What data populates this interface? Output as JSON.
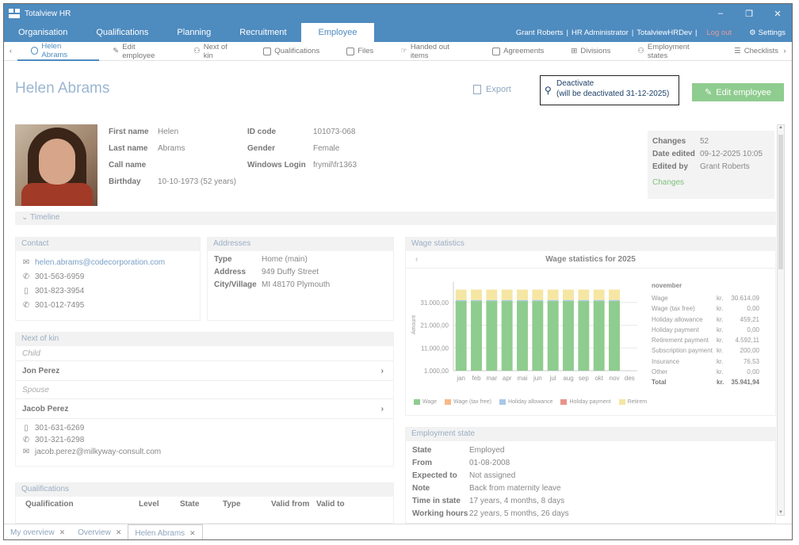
{
  "window": {
    "title": "Totalview HR",
    "minimize": "–",
    "restore": "❐",
    "close": "✕"
  },
  "main_nav": {
    "tabs": [
      "Organisation",
      "Qualifications",
      "Planning",
      "Recruitment",
      "Employee"
    ],
    "active": "Employee",
    "user": "Grant Roberts",
    "role": "HR Administrator",
    "instance": "TotalviewHRDev",
    "sep": "|",
    "logout": "Log out",
    "settings": "Settings"
  },
  "sub_nav": {
    "items": [
      "Helen Abrams",
      "Edit employee",
      "Next of kin",
      "Qualifications",
      "Files",
      "Handed out items",
      "Agreements",
      "Divisions",
      "Employment states",
      "Checklists"
    ],
    "left_arrow": "‹",
    "right_arrow": "›"
  },
  "header": {
    "name": "Helen Abrams",
    "export": "Export",
    "deactivate": "Deactivate",
    "deactivate_note": "(will be deactivated 31-12-2025)",
    "edit_button": "Edit employee"
  },
  "person": {
    "first_name_label": "First name",
    "first_name": "Helen",
    "last_name_label": "Last name",
    "last_name": "Abrams",
    "call_name_label": "Call name",
    "call_name": "",
    "birthday_label": "Birthday",
    "birthday": "10-10-1973 (52 years)",
    "id_label": "ID code",
    "id": "101073-068",
    "gender_label": "Gender",
    "gender": "Female",
    "login_label": "Windows Login",
    "login": "frymil\\fr1363"
  },
  "meta": {
    "changes_label": "Changes",
    "changes": "52",
    "edited_label": "Date edited",
    "edited": "09-12-2025 10:05",
    "by_label": "Edited by",
    "by": "Grant Roberts",
    "link": "Changes"
  },
  "timeline": {
    "label": "Timeline",
    "chevron": "⌄"
  },
  "contact": {
    "title": "Contact",
    "email": "helen.abrams@codecorporation.com",
    "phone1": "301-563-6959",
    "phone2": "301-823-3954",
    "phone3": "301-012-7495"
  },
  "addresses": {
    "title": "Addresses",
    "type_label": "Type",
    "type": "Home (main)",
    "address_label": "Address",
    "address": "949 Duffy Street",
    "city_label": "City/Village",
    "city": "MI 48170 Plymouth"
  },
  "next_of_kin": {
    "title": "Next of kin",
    "child_label": "Child",
    "child_name": "Jon Perez",
    "spouse_label": "Spouse",
    "spouse_name": "Jacob Perez",
    "spouse_mobile": "301-631-6269",
    "spouse_phone": "301-321-6298",
    "spouse_email": "jacob.perez@milkyway-consult.com",
    "chevron": "›"
  },
  "qualifications": {
    "title": "Qualifications",
    "columns": [
      "Qualification",
      "Level",
      "State",
      "Type",
      "Valid from",
      "Valid to"
    ]
  },
  "wage": {
    "title": "Wage statistics",
    "chart_title": "Wage statistics for 2025",
    "back": "‹",
    "month": "november",
    "rows": [
      {
        "name": "Wage",
        "cur": "kr.",
        "amount": "30.614,09"
      },
      {
        "name": "Wage (tax free)",
        "cur": "kr.",
        "amount": "0,00"
      },
      {
        "name": "Holiday allowance",
        "cur": "kr.",
        "amount": "459,21"
      },
      {
        "name": "Holiday payment",
        "cur": "kr.",
        "amount": "0,00"
      },
      {
        "name": "Retirement payment",
        "cur": "kr.",
        "amount": "4.592,11"
      },
      {
        "name": "Subscription payment",
        "cur": "kr.",
        "amount": "200,00"
      },
      {
        "name": "Insurance",
        "cur": "kr.",
        "amount": "76,53"
      },
      {
        "name": "Other",
        "cur": "kr.",
        "amount": "0,00"
      },
      {
        "name": "Total",
        "cur": "kr.",
        "amount": "35.941,94"
      }
    ]
  },
  "employment": {
    "title": "Employment state",
    "state_label": "State",
    "state": "Employed",
    "from_label": "From",
    "from": "01-08-2008",
    "expected_label": "Expected to",
    "expected": "Not assigned",
    "note_label": "Note",
    "note": "Back from maternity leave",
    "time_label": "Time in state",
    "time": "17 years, 4 months, 8 days",
    "hours_label": "Working hours",
    "hours": "22 years, 5 months, 26 days"
  },
  "bottom_tabs": [
    "My overview",
    "Overview",
    "Helen Abrams"
  ],
  "colors": {
    "primary": "#4e8bbf",
    "green": "#8fcc8f",
    "wage": "#8fcc8f",
    "retirement": "#f5e6a3"
  },
  "chart_data": {
    "type": "bar",
    "categories": [
      "jan",
      "feb",
      "mar",
      "apr",
      "mai",
      "jun",
      "jul",
      "aug",
      "sep",
      "okt",
      "nov",
      "des"
    ],
    "ylabel": "Amount",
    "yticks": [
      "1.000,00",
      "11.000,00",
      "21.000,00",
      "31.000,00"
    ],
    "ylim": [
      1000,
      40000
    ],
    "stacked": true,
    "series": [
      {
        "name": "Wage",
        "color": "#8fcc8f",
        "values": [
          30614,
          30614,
          30614,
          30614,
          30614,
          30614,
          30614,
          30614,
          30614,
          30614,
          30614,
          0
        ]
      },
      {
        "name": "Wage (tax free)",
        "color": "#f5b98a",
        "values": [
          0,
          0,
          0,
          0,
          0,
          0,
          0,
          0,
          0,
          0,
          0,
          0
        ]
      },
      {
        "name": "Holiday allowance",
        "color": "#a8c8e6",
        "values": [
          459,
          459,
          459,
          459,
          459,
          459,
          459,
          459,
          459,
          459,
          459,
          0
        ]
      },
      {
        "name": "Holiday payment",
        "color": "#e6958a",
        "values": [
          0,
          0,
          0,
          0,
          0,
          0,
          0,
          0,
          0,
          0,
          0,
          0
        ]
      },
      {
        "name": "Retirement payment",
        "label": "Retirem",
        "color": "#f5e6a3",
        "values": [
          4592,
          4592,
          4592,
          4592,
          4592,
          4592,
          4592,
          4592,
          4592,
          4592,
          4592,
          0
        ]
      }
    ]
  }
}
